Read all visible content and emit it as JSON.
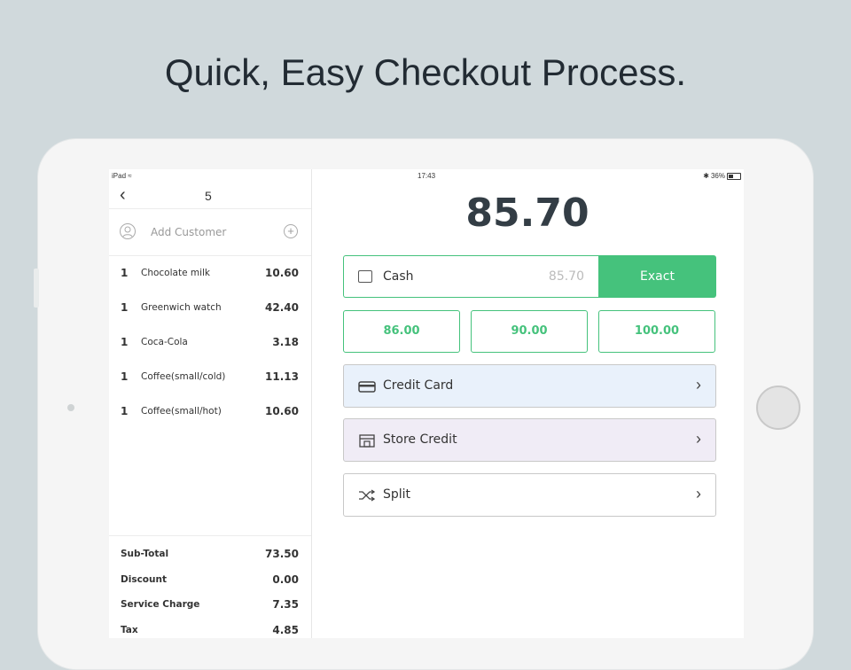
{
  "headline": "Quick, Easy Checkout Process.",
  "status_bar": {
    "carrier": "iPad",
    "time": "17:43",
    "battery": "36%"
  },
  "order": {
    "back_icon": "chevron-left-icon",
    "number": "5"
  },
  "customer": {
    "label": "Add Customer",
    "icon": "person-icon",
    "add_icon": "plus-circle-icon"
  },
  "items": [
    {
      "qty": "1",
      "name": "Chocolate milk",
      "price": "10.60"
    },
    {
      "qty": "1",
      "name": "Greenwich watch",
      "price": "42.40"
    },
    {
      "qty": "1",
      "name": "Coca-Cola",
      "price": "3.18"
    },
    {
      "qty": "1",
      "name": "Coffee(small/cold)",
      "price": "11.13"
    },
    {
      "qty": "1",
      "name": "Coffee(small/hot)",
      "price": "10.60"
    }
  ],
  "totals": [
    {
      "label": "Sub-Total",
      "value": "73.50"
    },
    {
      "label": "Discount",
      "value": "0.00"
    },
    {
      "label": "Service Charge",
      "value": "7.35"
    },
    {
      "label": "Tax",
      "value": "4.85"
    }
  ],
  "payment": {
    "total": "85.70",
    "cash": {
      "label": "Cash",
      "amount": "85.70",
      "exact_label": "Exact",
      "icon": "wallet-icon"
    },
    "quick_amounts": [
      "86.00",
      "90.00",
      "100.00"
    ],
    "methods": [
      {
        "label": "Credit Card",
        "icon": "credit-card-icon",
        "bg": "#e9f1fb"
      },
      {
        "label": "Store Credit",
        "icon": "store-icon",
        "bg": "#f0ecf6"
      },
      {
        "label": "Split",
        "icon": "shuffle-icon",
        "bg": "#ffffff"
      }
    ]
  },
  "colors": {
    "accent": "#45c27c",
    "page_bg": "#d0d9dc",
    "text_dark": "#333d45"
  }
}
